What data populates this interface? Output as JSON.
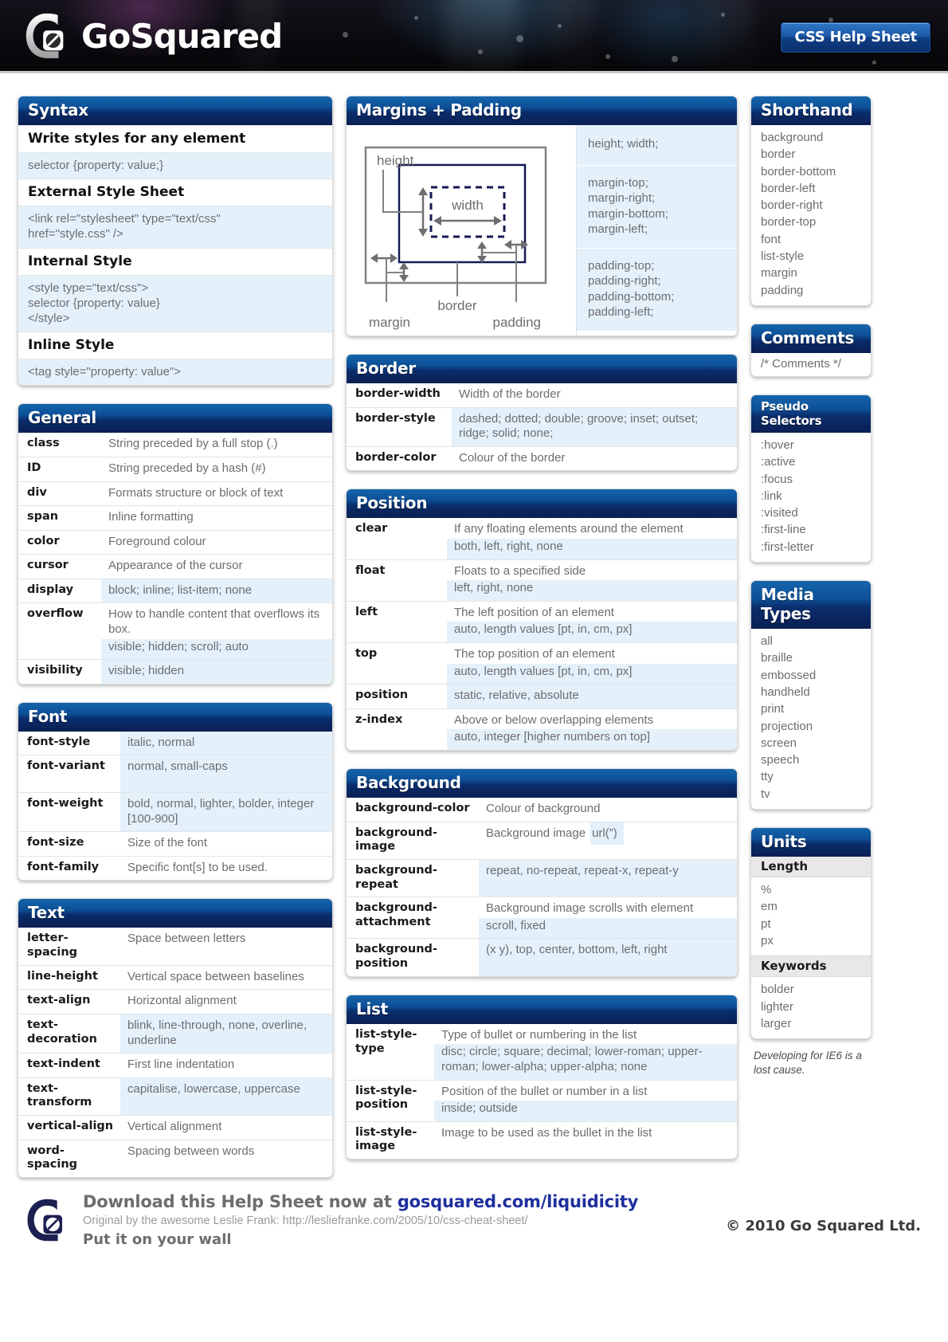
{
  "header": {
    "brand": "GoSquared",
    "badge": "CSS Help Sheet",
    "logo_icon": "gosquared-logo-icon"
  },
  "syntax": {
    "title": "Syntax",
    "entries": [
      {
        "heading": "Write styles for any element",
        "code": [
          "selector {property: value;}"
        ]
      },
      {
        "heading": "External Style Sheet",
        "code": [
          "<link rel=\"stylesheet\" type=\"text/css\"",
          "href=\"style.css\" />"
        ]
      },
      {
        "heading": "Internal Style",
        "code": [
          "<style type=\"text/css\">",
          "selector {property: value}",
          "</style>"
        ]
      },
      {
        "heading": "Inline Style",
        "code": [
          "<tag style=\"property: value\">"
        ]
      }
    ]
  },
  "general": {
    "title": "General",
    "rows": [
      {
        "k": "class",
        "desc": "String preceded by a full stop (.)",
        "vals": ""
      },
      {
        "k": "ID",
        "desc": "String preceded by a hash (#)",
        "vals": ""
      },
      {
        "k": "div",
        "desc": "Formats structure or block of text",
        "vals": ""
      },
      {
        "k": "span",
        "desc": "Inline formatting",
        "vals": ""
      },
      {
        "k": "color",
        "desc": "Foreground colour",
        "vals": ""
      },
      {
        "k": "cursor",
        "desc": "Appearance of the cursor",
        "vals": ""
      },
      {
        "k": "display",
        "desc": "",
        "vals": "block; inline; list-item; none"
      },
      {
        "k": "overflow",
        "desc": "How to handle content that overflows its box.",
        "vals": "visible; hidden; scroll; auto"
      },
      {
        "k": "visibility",
        "desc": "",
        "vals": "visible; hidden"
      }
    ]
  },
  "font": {
    "title": "Font",
    "rows": [
      {
        "k": "font-style",
        "desc": "",
        "vals": "italic, normal"
      },
      {
        "k": "font-variant",
        "desc": "",
        "vals": "normal, small-caps"
      },
      {
        "k": "font-weight",
        "desc": "",
        "vals": "bold, normal, lighter, bolder, integer [100-900]"
      },
      {
        "k": "font-size",
        "desc": "Size of the font",
        "vals": ""
      },
      {
        "k": "font-family",
        "desc": "Specific font[s] to be used.",
        "vals": ""
      }
    ]
  },
  "text": {
    "title": "Text",
    "rows": [
      {
        "k": "letter-spacing",
        "desc": "Space between letters",
        "vals": ""
      },
      {
        "k": "line-height",
        "desc": "Vertical space between baselines",
        "vals": ""
      },
      {
        "k": "text-align",
        "desc": "Horizontal alignment",
        "vals": ""
      },
      {
        "k": "text-decoration",
        "desc": "",
        "vals": "blink, line-through, none, overline, underline"
      },
      {
        "k": "text-indent",
        "desc": "First line indentation",
        "vals": ""
      },
      {
        "k": "text-transform",
        "desc": "",
        "vals": "capitalise, lowercase, uppercase"
      },
      {
        "k": "vertical-align",
        "desc": "Vertical alignment",
        "vals": ""
      },
      {
        "k": "word-spacing",
        "desc": "Spacing between words",
        "vals": ""
      }
    ]
  },
  "margins_padding": {
    "title": "Margins + Padding",
    "diagram": {
      "label_height": "height",
      "label_width": "width",
      "label_border": "border",
      "label_margin": "margin",
      "label_padding": "padding"
    },
    "cells": [
      [
        "height; width;"
      ],
      [
        "margin-top;",
        "margin-right;",
        "margin-bottom;",
        "margin-left;"
      ],
      [
        "padding-top;",
        "padding-right;",
        "padding-bottom;",
        "padding-left;"
      ]
    ]
  },
  "border": {
    "title": "Border",
    "rows": [
      {
        "k": "border-width",
        "desc": "Width of the border",
        "vals": ""
      },
      {
        "k": "border-style",
        "desc": "",
        "vals": "dashed; dotted; double; groove; inset; outset; ridge; solid; none;"
      },
      {
        "k": "border-color",
        "desc": "Colour of the border",
        "vals": ""
      }
    ]
  },
  "position": {
    "title": "Position",
    "rows": [
      {
        "k": "clear",
        "desc": "If any floating elements around the element",
        "vals": "both, left, right, none"
      },
      {
        "k": "float",
        "desc": "Floats to a specified side",
        "vals": "left, right, none"
      },
      {
        "k": "left",
        "desc": "The left position of an element",
        "vals": "auto, length values [pt, in, cm, px]"
      },
      {
        "k": "top",
        "desc": "The top position of an element",
        "vals": "auto, length values [pt, in, cm, px]"
      },
      {
        "k": "position",
        "desc": "",
        "vals": "static, relative, absolute"
      },
      {
        "k": "z-index",
        "desc": "Above or below overlapping elements",
        "vals": "auto, integer [higher numbers on top]"
      }
    ]
  },
  "background": {
    "title": "Background",
    "rows": [
      {
        "k": "background-color",
        "desc": "Colour of background",
        "vals": ""
      },
      {
        "k": "background-image",
        "desc": "Background image",
        "vals": "url(”)",
        "inline": true
      },
      {
        "k": "background-repeat",
        "desc": "",
        "vals": "repeat, no-repeat, repeat-x, repeat-y"
      },
      {
        "k": "background-attachment",
        "desc": "Background image scrolls with element",
        "vals": "scroll, fixed"
      },
      {
        "k": "background-position",
        "desc": "",
        "vals": "(x y), top, center, bottom, left, right"
      }
    ]
  },
  "list": {
    "title": "List",
    "rows": [
      {
        "k": "list-style-type",
        "desc": "Type of bullet or numbering in the list",
        "vals": "disc; circle; square; decimal; lower-roman; upper-roman; lower-alpha; upper-alpha; none"
      },
      {
        "k": "list-style-position",
        "desc": "Position of the bullet or number in a list",
        "vals": "inside; outside"
      },
      {
        "k": "list-style-image",
        "desc": "Image to be used as the bullet in the list",
        "vals": ""
      }
    ]
  },
  "shorthand": {
    "title": "Shorthand",
    "items": [
      "background",
      "border",
      "border-bottom",
      "border-left",
      "border-right",
      "border-top",
      "font",
      "list-style",
      "margin",
      "padding"
    ]
  },
  "comments": {
    "title": "Comments",
    "body": "/* Comments */"
  },
  "pseudo_selectors": {
    "title": "Pseudo Selectors",
    "items": [
      ":hover",
      ":active",
      ":focus",
      ":link",
      ":visited",
      ":first-line",
      ":first-letter"
    ]
  },
  "media_types": {
    "title": "Media Types",
    "items": [
      "all",
      "braille",
      "embossed",
      "handheld",
      "print",
      "projection",
      "screen",
      "speech",
      "tty",
      "tv"
    ]
  },
  "units": {
    "title": "Units",
    "length_label": "Length",
    "length_items": [
      "%",
      "em",
      "pt",
      "px"
    ],
    "keywords_label": "Keywords",
    "keyword_items": [
      "bolder",
      "lighter",
      "larger"
    ]
  },
  "ie_note": "Developing for IE6 is a lost cause.",
  "footer": {
    "logo_icon": "gosquared-logo-icon",
    "line1_prefix": "Download this Help Sheet now at ",
    "line1_link": "gosquared.com/liquidicity",
    "line2": "Original by the awesome Leslie Frank: http://lesliefranke.com/2005/10/css-cheat-sheet/",
    "line3": "Put it on your wall",
    "copyright": "© 2010 Go Squared Ltd."
  },
  "colors": {
    "title_bar_top": "#1565ad",
    "title_bar_bottom": "#0b1f52",
    "zebra": "#e4f1fb",
    "badge_blue": "#1d5aa8",
    "link_blue": "#1f2f9e",
    "body_text": "#6d6d70"
  }
}
